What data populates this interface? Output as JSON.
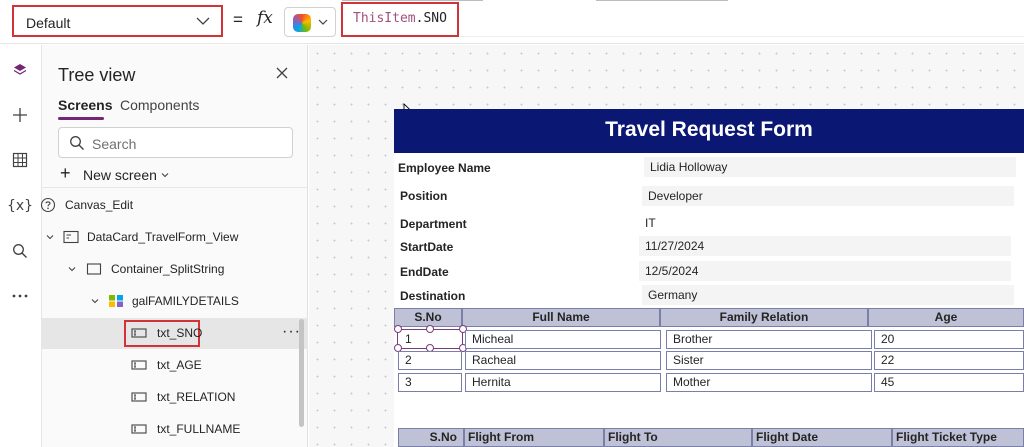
{
  "formula_bar": {
    "property": "Default",
    "equals": "=",
    "fx": "fx",
    "formula_keyword": "ThisItem",
    "formula_rest": ".SNO"
  },
  "rail": {
    "icons": [
      "layers-icon",
      "plus-icon",
      "table-icon",
      "variables-icon",
      "search-icon",
      "more-icon"
    ],
    "variables_label": "{x}",
    "more_label": "..."
  },
  "tree": {
    "title": "Tree view",
    "tabs": [
      "Screens",
      "Components"
    ],
    "search_placeholder": "Search",
    "new_screen": "New screen",
    "nodes": [
      {
        "label": "Canvas_Edit"
      },
      {
        "label": "DataCard_TravelForm_View"
      },
      {
        "label": "Container_SplitString"
      },
      {
        "label": "galFAMILYDETAILS"
      },
      {
        "label": "txt_SNO"
      },
      {
        "label": "txt_AGE"
      },
      {
        "label": "txt_RELATION"
      },
      {
        "label": "txt_FULLNAME"
      }
    ],
    "more": "···"
  },
  "form": {
    "title": "Travel Request Form",
    "fields": [
      {
        "label": "Employee Name",
        "value": "Lidia Holloway"
      },
      {
        "label": "Position",
        "value": "Developer"
      },
      {
        "label": "Department",
        "value": "IT"
      },
      {
        "label": "StartDate",
        "value": "11/27/2024"
      },
      {
        "label": "EndDate",
        "value": "12/5/2024"
      },
      {
        "label": "Destination",
        "value": "Germany"
      }
    ],
    "family_headers": [
      "S.No",
      "Full Name",
      "Family Relation",
      "Age"
    ],
    "family_rows": [
      [
        "1",
        "Micheal",
        "Brother",
        "20"
      ],
      [
        "2",
        "Racheal",
        "Sister",
        "22"
      ],
      [
        "3",
        "Hernita",
        "Mother",
        "45"
      ]
    ],
    "flight_headers": [
      "S.No",
      "Flight From",
      "Flight To",
      "Flight Date",
      "Flight Ticket Type"
    ]
  },
  "colors": {
    "accent": "#742774",
    "header": "#0b1873",
    "highlight": "#d13438"
  }
}
